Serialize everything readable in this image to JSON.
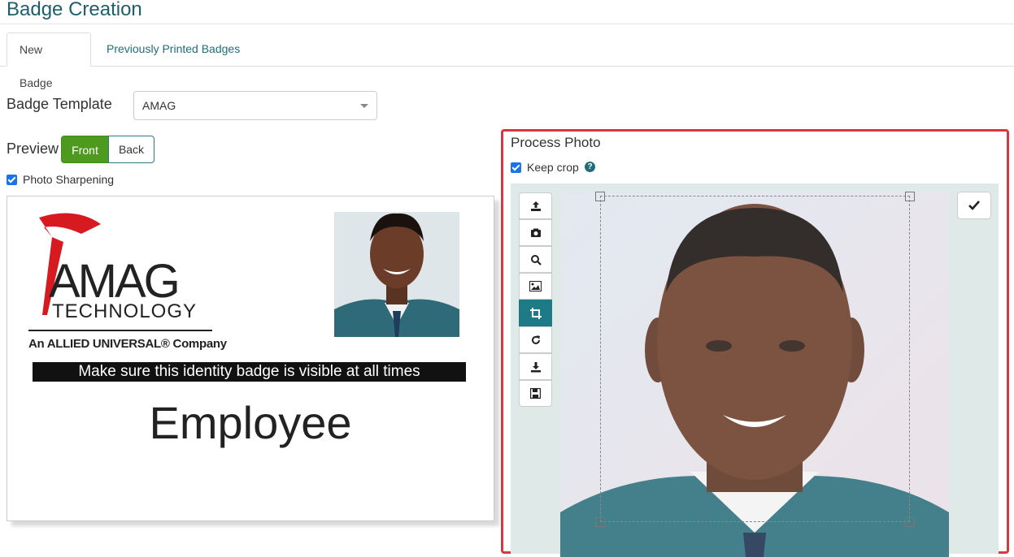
{
  "page": {
    "title": "Badge Creation"
  },
  "tabs": [
    {
      "label": "New Badge",
      "active": true
    },
    {
      "label": "Previously Printed Badges",
      "active": false
    }
  ],
  "template": {
    "label": "Badge Template",
    "selected": "AMAG"
  },
  "preview": {
    "label": "Preview",
    "front_label": "Front",
    "back_label": "Back",
    "selected": "Front"
  },
  "photo_sharpening": {
    "label": "Photo Sharpening",
    "checked": true
  },
  "badge": {
    "logo_line1": "AMAG",
    "logo_line2": "TECHNOLOGY",
    "tagline": "An ALLIED UNIVERSAL® Company",
    "banner": "Make sure this identity badge is visible at all times",
    "role": "Employee"
  },
  "process_photo": {
    "title": "Process Photo",
    "keep_crop": {
      "label": "Keep crop",
      "checked": true
    },
    "help_icon": "?",
    "tools": [
      "upload-icon",
      "camera-icon",
      "search-icon",
      "image-icon",
      "crop-icon",
      "rotate-icon",
      "download-icon",
      "save-icon"
    ],
    "active_tool": "crop-icon"
  },
  "colors": {
    "accent": "#1f7a88",
    "front_button": "#4e9a1f",
    "highlight_border": "#d9363e",
    "logo_red": "#d71920"
  }
}
